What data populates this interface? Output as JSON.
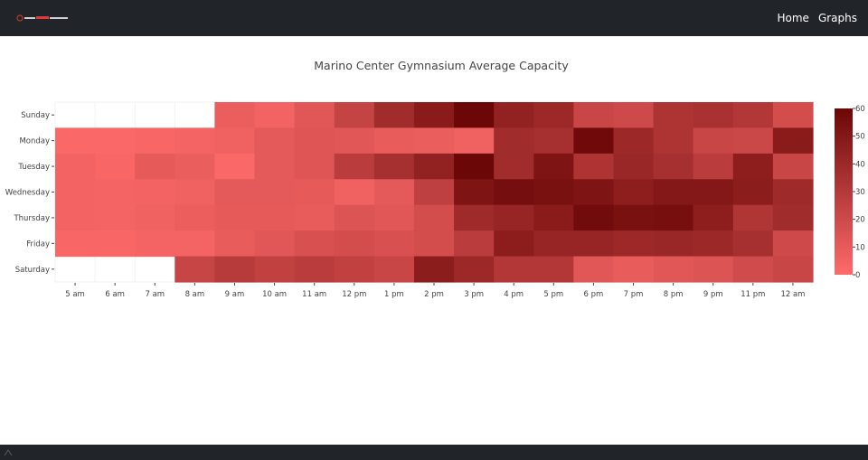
{
  "nav": {
    "links": [
      "Home",
      "Graphs"
    ]
  },
  "chart_data": {
    "type": "heatmap",
    "title": "Marino Center Gymnasium Average Capacity",
    "x": [
      "5 am",
      "6 am",
      "7 am",
      "8 am",
      "9 am",
      "10 am",
      "11 am",
      "12 pm",
      "1 pm",
      "2 pm",
      "3 pm",
      "4 pm",
      "5 pm",
      "6 pm",
      "7 pm",
      "8 pm",
      "9 pm",
      "11 pm",
      "12 am"
    ],
    "y": [
      "Sunday",
      "Monday",
      "Tuesday",
      "Wednesday",
      "Thursday",
      "Friday",
      "Saturday"
    ],
    "z": [
      [
        null,
        null,
        null,
        null,
        8,
        5,
        12,
        24,
        38,
        48,
        62,
        44,
        40,
        22,
        20,
        33,
        35,
        31,
        18
      ],
      [
        2,
        2,
        3,
        4,
        6,
        11,
        13,
        12,
        9,
        8,
        6,
        38,
        36,
        58,
        40,
        33,
        22,
        21,
        48
      ],
      [
        5,
        3,
        10,
        8,
        2,
        11,
        13,
        28,
        36,
        44,
        62,
        38,
        52,
        33,
        41,
        36,
        28,
        46,
        22
      ],
      [
        5,
        4,
        5,
        6,
        11,
        11,
        10,
        6,
        11,
        26,
        52,
        56,
        54,
        52,
        46,
        50,
        50,
        47,
        39
      ],
      [
        5,
        4,
        6,
        8,
        10,
        10,
        9,
        14,
        12,
        18,
        39,
        42,
        48,
        57,
        54,
        55,
        46,
        32,
        38
      ],
      [
        3,
        3,
        4,
        4,
        9,
        12,
        16,
        18,
        16,
        18,
        28,
        47,
        42,
        42,
        40,
        41,
        40,
        36,
        20
      ],
      [
        null,
        null,
        null,
        23,
        29,
        25,
        28,
        25,
        22,
        47,
        40,
        31,
        31,
        12,
        9,
        12,
        14,
        19,
        22
      ]
    ],
    "colorscale": [
      "#ff6b6b",
      "#6b0707"
    ],
    "zlim": [
      0,
      60
    ],
    "colorbar_ticks": [
      0,
      10,
      20,
      30,
      40,
      50,
      60
    ],
    "colorbar_placement": "right"
  }
}
